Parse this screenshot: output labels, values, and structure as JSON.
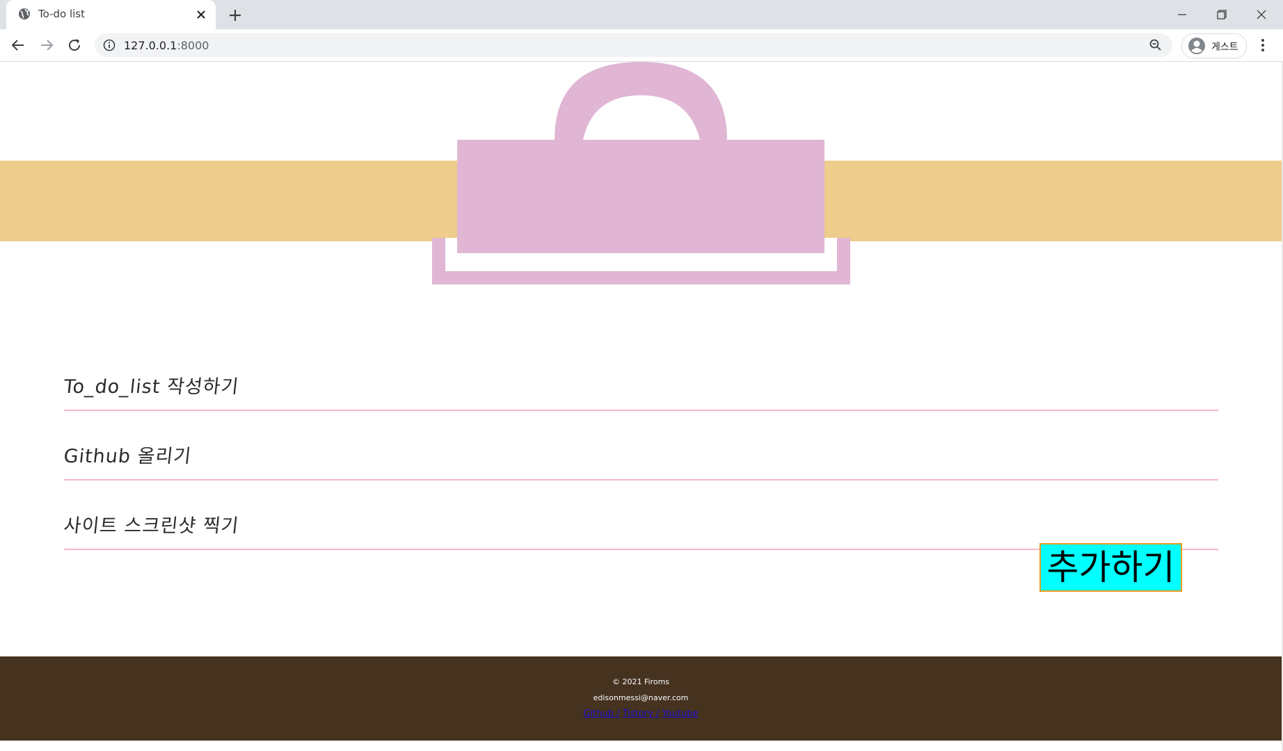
{
  "browser": {
    "tab_title": "To-do list",
    "url_host": "127.0.0.1",
    "url_port": ":8000",
    "profile_label": "게스트",
    "icons": {
      "favicon": "globe-icon",
      "tab_close": "close-icon",
      "new_tab": "plus-icon",
      "back": "arrow-left-icon",
      "forward": "arrow-right-icon",
      "reload": "reload-icon",
      "site_info": "info-icon",
      "zoom": "zoom-icon",
      "menu": "kebab-menu-icon"
    }
  },
  "colors": {
    "band": "#eecc8c",
    "bag": "#e0b6d4",
    "item_border": "#f6b7c5",
    "button_bg": "#00ffff",
    "button_border": "#ee9a1a",
    "footer_bg": "#45321f",
    "footer_link": "#1a0dcc"
  },
  "todos": [
    {
      "text": "To_do_list 작성하기"
    },
    {
      "text": "Github 올리기"
    },
    {
      "text": "사이트 스크린샷 찍기"
    }
  ],
  "add_button_label": "추가하기",
  "footer": {
    "copyright": "© 2021 Firoms",
    "email": "edisonmessi@naver.com",
    "links": [
      {
        "label": "Github /"
      },
      {
        "label": "Tistory /"
      },
      {
        "label": "Youtube"
      }
    ]
  }
}
